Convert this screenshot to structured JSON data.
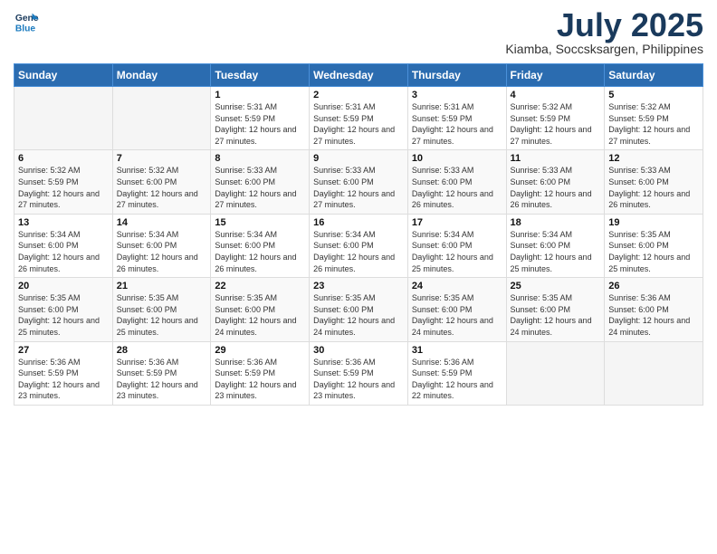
{
  "logo": {
    "line1": "General",
    "line2": "Blue"
  },
  "title": "July 2025",
  "location": "Kiamba, Soccsksargen, Philippines",
  "days_of_week": [
    "Sunday",
    "Monday",
    "Tuesday",
    "Wednesday",
    "Thursday",
    "Friday",
    "Saturday"
  ],
  "weeks": [
    [
      {
        "day": "",
        "info": ""
      },
      {
        "day": "",
        "info": ""
      },
      {
        "day": "1",
        "info": "Sunrise: 5:31 AM\nSunset: 5:59 PM\nDaylight: 12 hours and 27 minutes."
      },
      {
        "day": "2",
        "info": "Sunrise: 5:31 AM\nSunset: 5:59 PM\nDaylight: 12 hours and 27 minutes."
      },
      {
        "day": "3",
        "info": "Sunrise: 5:31 AM\nSunset: 5:59 PM\nDaylight: 12 hours and 27 minutes."
      },
      {
        "day": "4",
        "info": "Sunrise: 5:32 AM\nSunset: 5:59 PM\nDaylight: 12 hours and 27 minutes."
      },
      {
        "day": "5",
        "info": "Sunrise: 5:32 AM\nSunset: 5:59 PM\nDaylight: 12 hours and 27 minutes."
      }
    ],
    [
      {
        "day": "6",
        "info": "Sunrise: 5:32 AM\nSunset: 5:59 PM\nDaylight: 12 hours and 27 minutes."
      },
      {
        "day": "7",
        "info": "Sunrise: 5:32 AM\nSunset: 6:00 PM\nDaylight: 12 hours and 27 minutes."
      },
      {
        "day": "8",
        "info": "Sunrise: 5:33 AM\nSunset: 6:00 PM\nDaylight: 12 hours and 27 minutes."
      },
      {
        "day": "9",
        "info": "Sunrise: 5:33 AM\nSunset: 6:00 PM\nDaylight: 12 hours and 27 minutes."
      },
      {
        "day": "10",
        "info": "Sunrise: 5:33 AM\nSunset: 6:00 PM\nDaylight: 12 hours and 26 minutes."
      },
      {
        "day": "11",
        "info": "Sunrise: 5:33 AM\nSunset: 6:00 PM\nDaylight: 12 hours and 26 minutes."
      },
      {
        "day": "12",
        "info": "Sunrise: 5:33 AM\nSunset: 6:00 PM\nDaylight: 12 hours and 26 minutes."
      }
    ],
    [
      {
        "day": "13",
        "info": "Sunrise: 5:34 AM\nSunset: 6:00 PM\nDaylight: 12 hours and 26 minutes."
      },
      {
        "day": "14",
        "info": "Sunrise: 5:34 AM\nSunset: 6:00 PM\nDaylight: 12 hours and 26 minutes."
      },
      {
        "day": "15",
        "info": "Sunrise: 5:34 AM\nSunset: 6:00 PM\nDaylight: 12 hours and 26 minutes."
      },
      {
        "day": "16",
        "info": "Sunrise: 5:34 AM\nSunset: 6:00 PM\nDaylight: 12 hours and 26 minutes."
      },
      {
        "day": "17",
        "info": "Sunrise: 5:34 AM\nSunset: 6:00 PM\nDaylight: 12 hours and 25 minutes."
      },
      {
        "day": "18",
        "info": "Sunrise: 5:34 AM\nSunset: 6:00 PM\nDaylight: 12 hours and 25 minutes."
      },
      {
        "day": "19",
        "info": "Sunrise: 5:35 AM\nSunset: 6:00 PM\nDaylight: 12 hours and 25 minutes."
      }
    ],
    [
      {
        "day": "20",
        "info": "Sunrise: 5:35 AM\nSunset: 6:00 PM\nDaylight: 12 hours and 25 minutes."
      },
      {
        "day": "21",
        "info": "Sunrise: 5:35 AM\nSunset: 6:00 PM\nDaylight: 12 hours and 25 minutes."
      },
      {
        "day": "22",
        "info": "Sunrise: 5:35 AM\nSunset: 6:00 PM\nDaylight: 12 hours and 24 minutes."
      },
      {
        "day": "23",
        "info": "Sunrise: 5:35 AM\nSunset: 6:00 PM\nDaylight: 12 hours and 24 minutes."
      },
      {
        "day": "24",
        "info": "Sunrise: 5:35 AM\nSunset: 6:00 PM\nDaylight: 12 hours and 24 minutes."
      },
      {
        "day": "25",
        "info": "Sunrise: 5:35 AM\nSunset: 6:00 PM\nDaylight: 12 hours and 24 minutes."
      },
      {
        "day": "26",
        "info": "Sunrise: 5:36 AM\nSunset: 6:00 PM\nDaylight: 12 hours and 24 minutes."
      }
    ],
    [
      {
        "day": "27",
        "info": "Sunrise: 5:36 AM\nSunset: 5:59 PM\nDaylight: 12 hours and 23 minutes."
      },
      {
        "day": "28",
        "info": "Sunrise: 5:36 AM\nSunset: 5:59 PM\nDaylight: 12 hours and 23 minutes."
      },
      {
        "day": "29",
        "info": "Sunrise: 5:36 AM\nSunset: 5:59 PM\nDaylight: 12 hours and 23 minutes."
      },
      {
        "day": "30",
        "info": "Sunrise: 5:36 AM\nSunset: 5:59 PM\nDaylight: 12 hours and 23 minutes."
      },
      {
        "day": "31",
        "info": "Sunrise: 5:36 AM\nSunset: 5:59 PM\nDaylight: 12 hours and 22 minutes."
      },
      {
        "day": "",
        "info": ""
      },
      {
        "day": "",
        "info": ""
      }
    ]
  ]
}
